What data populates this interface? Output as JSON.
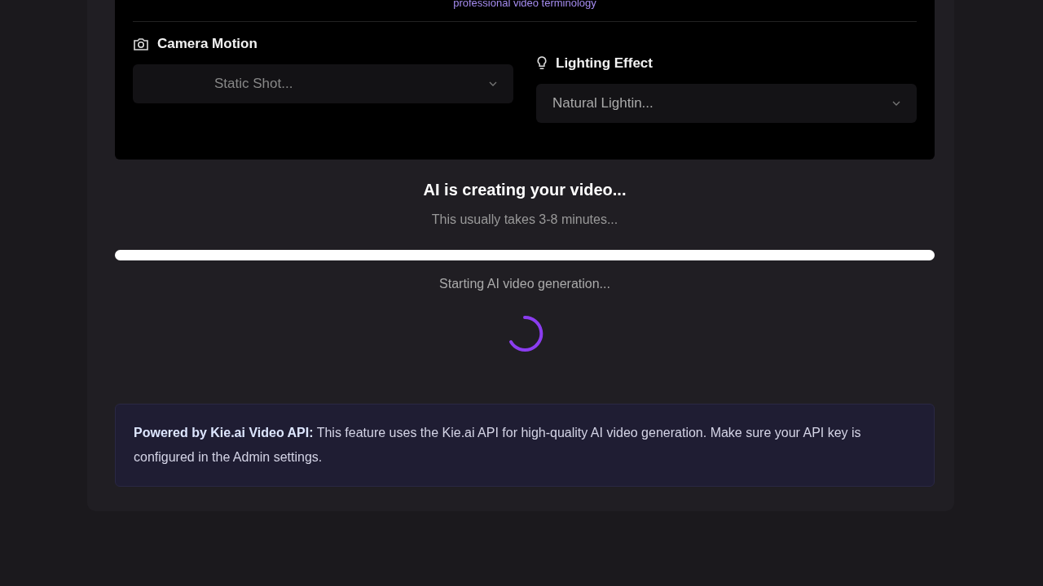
{
  "hint": "professional video terminology",
  "selects": [
    {
      "kind": "camera",
      "label": "Camera Motion",
      "value": "Static Shot..."
    },
    {
      "kind": "lighting",
      "label": "Lighting Effect",
      "value": "Natural Lightin..."
    }
  ],
  "status": {
    "title": "AI is creating your video...",
    "subtitle": "This usually takes 3-8 minutes...",
    "level": 1,
    "message": "Starting AI video generation..."
  },
  "notice": "**Powered by Kie.ai Video API:** This feature uses the Kie.ai API for high-quality AI video generation. Make sure your API key is configured in the Admin settings."
}
